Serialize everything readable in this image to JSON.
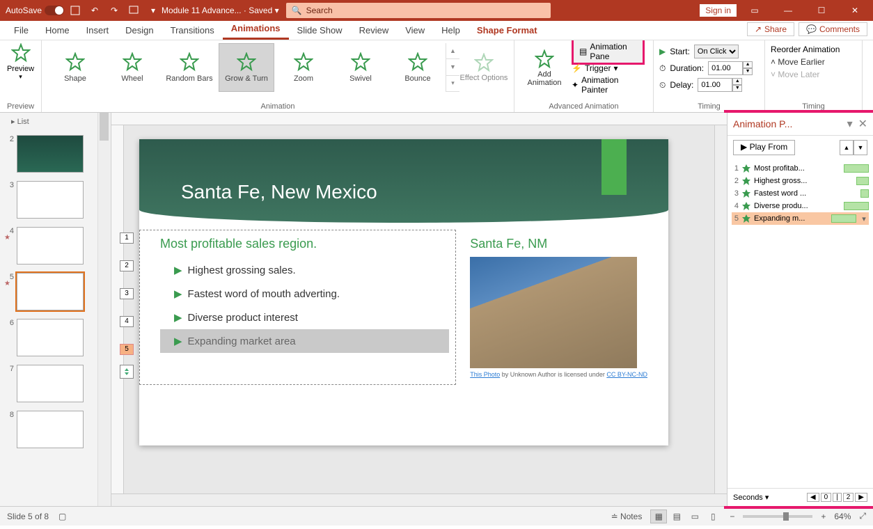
{
  "titlebar": {
    "autosave_label": "AutoSave",
    "autosave_state": "On",
    "document_name": "Module 11 Advance...",
    "saved_state": "Saved",
    "search_placeholder": "Search",
    "sign_in": "Sign in"
  },
  "tabs": {
    "file": "File",
    "home": "Home",
    "insert": "Insert",
    "design": "Design",
    "transitions": "Transitions",
    "animations": "Animations",
    "slideshow": "Slide Show",
    "review": "Review",
    "view": "View",
    "help": "Help",
    "shape_format": "Shape Format",
    "share": "Share",
    "comments": "Comments"
  },
  "ribbon": {
    "preview": "Preview",
    "preview_group": "Preview",
    "animation_group": "Animation",
    "effect_options": "Effect Options",
    "effects": {
      "shape": "Shape",
      "wheel": "Wheel",
      "random_bars": "Random Bars",
      "grow_turn": "Grow & Turn",
      "zoom": "Zoom",
      "swivel": "Swivel",
      "bounce": "Bounce"
    },
    "add_animation": "Add Animation",
    "animation_pane": "Animation Pane",
    "trigger": "Trigger",
    "animation_painter": "Animation Painter",
    "advanced_group": "Advanced Animation",
    "start_label": "Start:",
    "start_value": "On Click",
    "duration_label": "Duration:",
    "duration_value": "01.00",
    "delay_label": "Delay:",
    "delay_value": "01.00",
    "reorder": "Reorder Animation",
    "move_earlier": "Move Earlier",
    "move_later": "Move Later",
    "timing_group": "Timing"
  },
  "thumb_list_label": "List",
  "slides": [
    {
      "n": "2"
    },
    {
      "n": "3"
    },
    {
      "n": "4"
    },
    {
      "n": "5"
    },
    {
      "n": "6"
    },
    {
      "n": "7"
    },
    {
      "n": "8"
    }
  ],
  "slide5": {
    "title": "Santa Fe, New Mexico",
    "heading_left": "Most profitable sales region.",
    "bullets": [
      "Highest grossing sales.",
      "Fastest word of mouth adverting.",
      "Diverse product interest",
      "Expanding market area"
    ],
    "heading_right": "Santa Fe, NM",
    "caption_pre": "This Photo",
    "caption_mid": " by Unknown Author is licensed under ",
    "caption_link": "CC BY-NC-ND",
    "tags": [
      "1",
      "2",
      "3",
      "4",
      "5"
    ]
  },
  "anim_pane": {
    "title": "Animation P...",
    "play": "Play From",
    "items": [
      {
        "n": "1",
        "label": "Most profitab..."
      },
      {
        "n": "2",
        "label": "Highest gross..."
      },
      {
        "n": "3",
        "label": "Fastest word ..."
      },
      {
        "n": "4",
        "label": "Diverse produ..."
      },
      {
        "n": "5",
        "label": "Expanding m..."
      }
    ],
    "seconds": "Seconds",
    "range_lo": "0",
    "range_hi": "2"
  },
  "status": {
    "slide_info": "Slide 5 of 8",
    "notes": "Notes",
    "zoom": "64%"
  }
}
